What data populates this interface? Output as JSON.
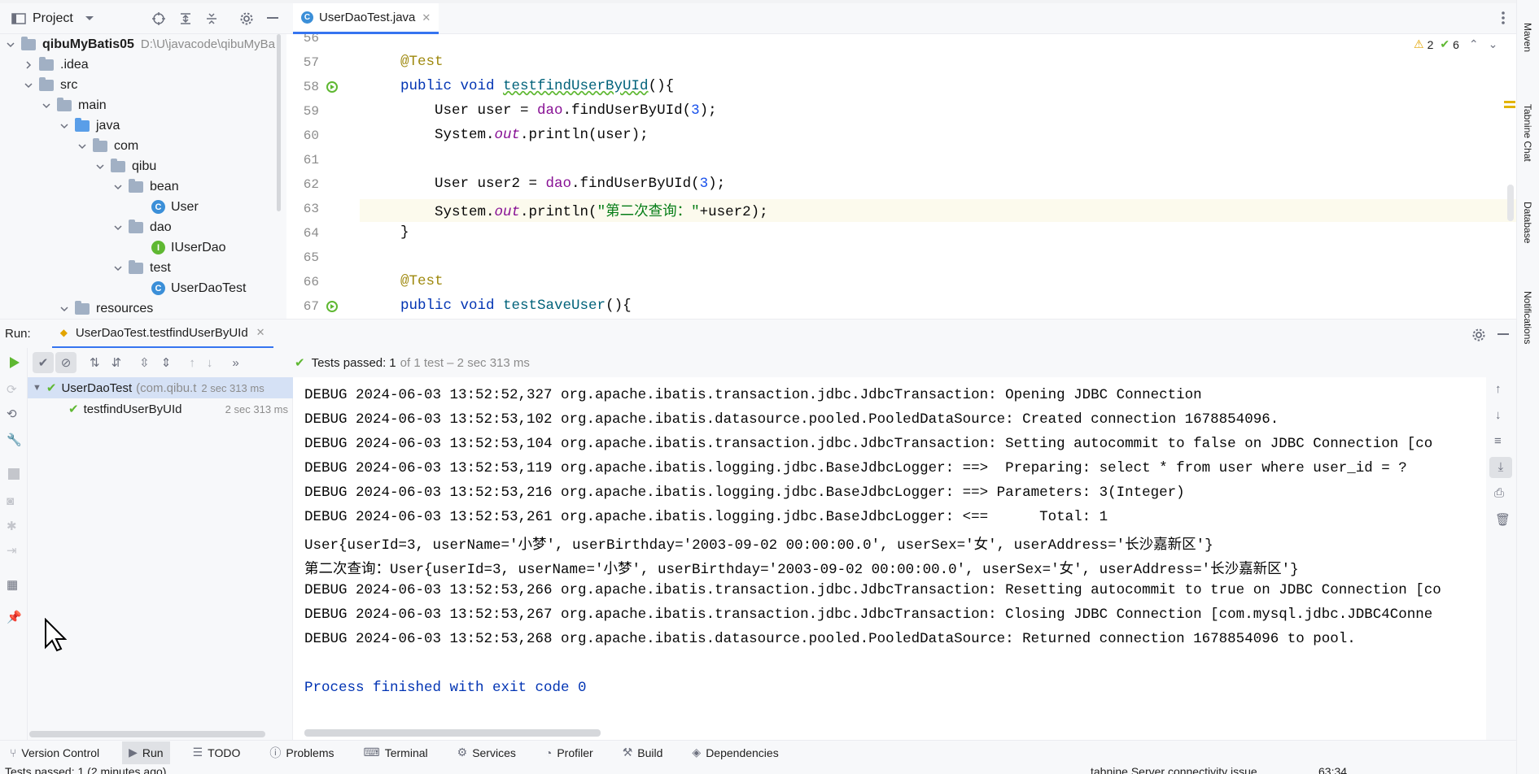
{
  "project": {
    "title": "Project",
    "root_name": "qibuMyBatis05",
    "root_path": "D:\\U\\javacode\\qibuMyBa",
    "items": [
      ".idea",
      "src",
      "main",
      "java",
      "com",
      "qibu",
      "bean",
      "User",
      "dao",
      "IUserDao",
      "test",
      "UserDaoTest",
      "resources"
    ]
  },
  "editor": {
    "tab_label": "UserDaoTest.java",
    "warnings": "2",
    "checks": "6",
    "line_numbers": [
      "56",
      "57",
      "58",
      "59",
      "60",
      "61",
      "62",
      "63",
      "64",
      "65",
      "66",
      "67"
    ]
  },
  "right_tools": [
    "Maven",
    "Tabnine Chat",
    "Database",
    "Notifications"
  ],
  "run": {
    "label": "Run:",
    "config_tab": "UserDaoTest.testfindUserByUId",
    "status_prefix": "Tests passed:",
    "status_count": "1",
    "status_rest": "of 1 test – 2 sec 313 ms",
    "tree": [
      {
        "name": "UserDaoTest",
        "pkg": "(com.qibu.t",
        "time": "2 sec 313 ms"
      },
      {
        "name": "testfindUserByUId",
        "time": "2 sec 313 ms"
      }
    ]
  },
  "console_lines": [
    "DEBUG 2024-06-03 13:52:52,327 org.apache.ibatis.transaction.jdbc.JdbcTransaction: Opening JDBC Connection",
    "DEBUG 2024-06-03 13:52:53,102 org.apache.ibatis.datasource.pooled.PooledDataSource: Created connection 1678854096.",
    "DEBUG 2024-06-03 13:52:53,104 org.apache.ibatis.transaction.jdbc.JdbcTransaction: Setting autocommit to false on JDBC Connection [co",
    "DEBUG 2024-06-03 13:52:53,119 org.apache.ibatis.logging.jdbc.BaseJdbcLogger: ==>  Preparing: select * from user where user_id = ?",
    "DEBUG 2024-06-03 13:52:53,216 org.apache.ibatis.logging.jdbc.BaseJdbcLogger: ==> Parameters: 3(Integer)",
    "DEBUG 2024-06-03 13:52:53,261 org.apache.ibatis.logging.jdbc.BaseJdbcLogger: <==      Total: 1",
    "User{userId=3, userName='小梦', userBirthday='2003-09-02 00:00:00.0', userSex='女', userAddress='长沙嘉新区'}",
    "第二次查询：User{userId=3, userName='小梦', userBirthday='2003-09-02 00:00:00.0', userSex='女', userAddress='长沙嘉新区'}",
    "DEBUG 2024-06-03 13:52:53,266 org.apache.ibatis.transaction.jdbc.JdbcTransaction: Resetting autocommit to true on JDBC Connection [co",
    "DEBUG 2024-06-03 13:52:53,267 org.apache.ibatis.transaction.jdbc.JdbcTransaction: Closing JDBC Connection [com.mysql.jdbc.JDBC4Conne",
    "DEBUG 2024-06-03 13:52:53,268 org.apache.ibatis.datasource.pooled.PooledDataSource: Returned connection 1678854096 to pool."
  ],
  "console_exit": "Process finished with exit code 0",
  "bottom_tools": [
    "Version Control",
    "Run",
    "TODO",
    "Problems",
    "Terminal",
    "Services",
    "Profiler",
    "Build",
    "Dependencies"
  ],
  "status_bar": {
    "left": "Tests passed: 1 (2 minutes ago)",
    "right": "tabnine Server connectivity issue",
    "position": "63:34"
  }
}
